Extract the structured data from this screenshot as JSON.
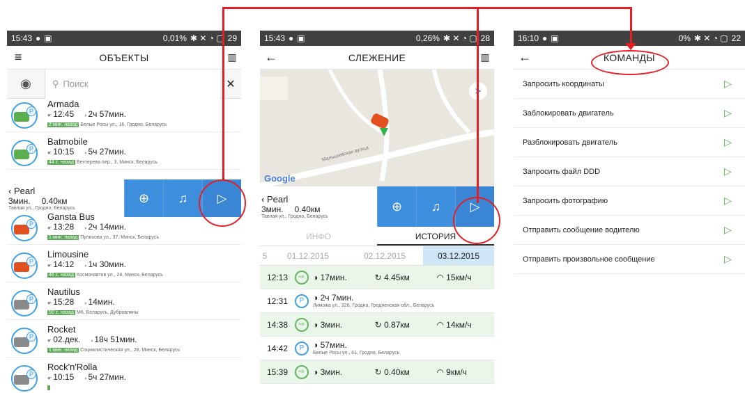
{
  "screen1": {
    "status": {
      "time": "15:43",
      "data": "0,01",
      "battery": "29"
    },
    "title": "ОБЪЕКТЫ",
    "search_placeholder": "Поиск",
    "objects": [
      {
        "name": "Armada",
        "time": "12:45",
        "dur": "2ч 57мин.",
        "tag": "2 мин. назад",
        "addr": "Белые Росы ул., 16, Гродно, Беларусь",
        "car": "#5caf4e"
      },
      {
        "name": "Batmobile",
        "time": "10:15",
        "dur": "5ч 27мин.",
        "tag": "44 с. назад",
        "addr": "Бехтерева пер., 3, Минск, Беларусь",
        "car": "#5caf4e"
      },
      {
        "name": "Gansta Bus",
        "time": "13:28",
        "dur": "2ч 14мин.",
        "tag": "1 мин. назад",
        "addr": "Пулихова ул., 37, Минск, Беларусь",
        "car": "#e1501f"
      },
      {
        "name": "Limousine",
        "time": "14:12",
        "dur": "1ч 30мин.",
        "tag": "46 с. назад",
        "addr": "Космонавтов ул., 28, Минск, Беларусь",
        "car": "#e1501f"
      },
      {
        "name": "Nautilus",
        "time": "15:28",
        "dur": "14мин.",
        "tag": "50 с. назад",
        "addr": "М6, Беларусь, Дубровляны",
        "car": "#8a8a8a"
      },
      {
        "name": "Rocket",
        "time": "02.дек.",
        "dur": "18ч 51мин.",
        "tag": "1 мин. назад",
        "addr": "Социалистическая ул., 28, Минск, Беларусь",
        "car": "#8a8a8a"
      },
      {
        "name": "Rock'n'Rolla",
        "time": "10:15",
        "dur": "5ч 27мин.",
        "tag": "",
        "addr": "",
        "car": "#8a8a8a"
      }
    ],
    "action_row": {
      "name": "Pearl",
      "dur": "3мин.",
      "dist": "0.40км",
      "addr": "Тавлая ул., Гродно, Беларусь"
    }
  },
  "screen2": {
    "status": {
      "time": "15:43",
      "data": "0,26",
      "battery": "28"
    },
    "title": "СЛЕЖЕНИЕ",
    "map_brand": "Google",
    "street": "Малышевская вулiца",
    "action_row": {
      "name": "Pearl",
      "dur": "3мин.",
      "dist": "0.40км",
      "addr": "Тавлая ул., Гродно, Беларусь"
    },
    "tabs": [
      "ИНФО",
      "ИСТОРИЯ"
    ],
    "dates": [
      "01.12.2015",
      "02.12.2015",
      "03.12.2015"
    ],
    "history": [
      {
        "time": "12:13",
        "v1": "17мин.",
        "v2": "4.45км",
        "v3": "15км/ч",
        "sub": ""
      },
      {
        "time": "12:31",
        "v1": "2ч 7мин.",
        "v2": "",
        "v3": "",
        "sub": "Лиможа ул., 326, Гродно, Гродненская обл., Беларусь"
      },
      {
        "time": "14:38",
        "v1": "3мин.",
        "v2": "0.87км",
        "v3": "14км/ч",
        "sub": ""
      },
      {
        "time": "14:42",
        "v1": "57мин.",
        "v2": "",
        "v3": "",
        "sub": "Белые Росы ул., 61, Гродно, Беларусь"
      },
      {
        "time": "15:39",
        "v1": "3мин.",
        "v2": "0.40км",
        "v3": "9км/ч",
        "sub": ""
      }
    ]
  },
  "screen3": {
    "status": {
      "time": "16:10",
      "data": "0",
      "battery": "22"
    },
    "title": "КОМАНДЫ",
    "commands": [
      "Запросить координаты",
      "Заблокировать двигатель",
      "Разблокировать двигатель",
      "Запросить файл DDD",
      "Запросить фотографию",
      "Отправить сообщение водителю",
      "Отправить произвольное сообщение"
    ]
  }
}
